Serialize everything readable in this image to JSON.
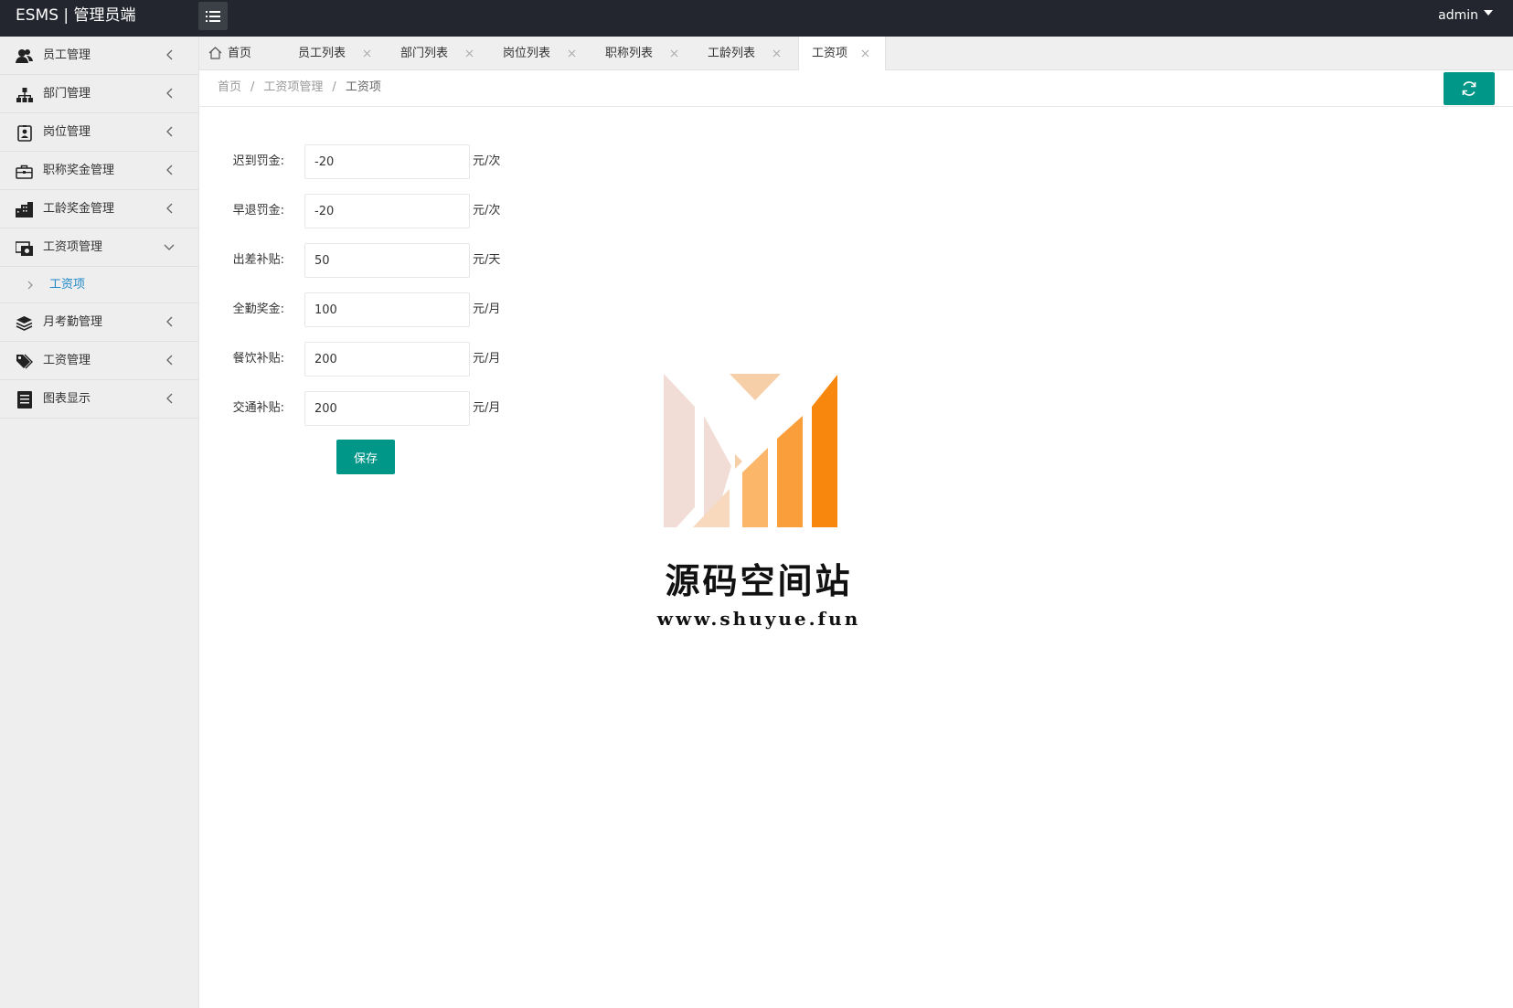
{
  "header": {
    "brand": "ESMS | 管理员端",
    "user": "admin"
  },
  "sidebar": {
    "items": [
      {
        "label": "员工管理",
        "icon": "users-icon"
      },
      {
        "label": "部门管理",
        "icon": "sitemap-icon"
      },
      {
        "label": "岗位管理",
        "icon": "id-badge-icon"
      },
      {
        "label": "职称奖金管理",
        "icon": "briefcase-icon"
      },
      {
        "label": "工龄奖金管理",
        "icon": "building-icon"
      },
      {
        "label": "工资项管理",
        "icon": "money-icon"
      },
      {
        "label": "月考勤管理",
        "icon": "layers-icon"
      },
      {
        "label": "工资管理",
        "icon": "tags-icon"
      },
      {
        "label": "图表显示",
        "icon": "report-icon"
      }
    ],
    "sub_item": "工资项"
  },
  "tabs": [
    {
      "label": "首页"
    },
    {
      "label": "员工列表"
    },
    {
      "label": "部门列表"
    },
    {
      "label": "岗位列表"
    },
    {
      "label": "职称列表"
    },
    {
      "label": "工龄列表"
    },
    {
      "label": "工资项"
    }
  ],
  "breadcrumb": {
    "home": "首页",
    "section": "工资项管理",
    "current": "工资项",
    "separator": "/"
  },
  "form": {
    "fields": [
      {
        "label": "迟到罚金:",
        "value": "-20",
        "unit": "元/次"
      },
      {
        "label": "早退罚金:",
        "value": "-20",
        "unit": "元/次"
      },
      {
        "label": "出差补贴:",
        "value": "50",
        "unit": "元/天"
      },
      {
        "label": "全勤奖金:",
        "value": "100",
        "unit": "元/月"
      },
      {
        "label": "餐饮补贴:",
        "value": "200",
        "unit": "元/月"
      },
      {
        "label": "交通补贴:",
        "value": "200",
        "unit": "元/月"
      }
    ],
    "save_label": "保存"
  },
  "watermark": {
    "title": "源码空间站",
    "url": "www.shuyue.fun"
  },
  "colors": {
    "accent": "#009688",
    "header_bg": "#23262e",
    "sidebar_bg": "#eeeeee",
    "link": "#1e88c8"
  }
}
